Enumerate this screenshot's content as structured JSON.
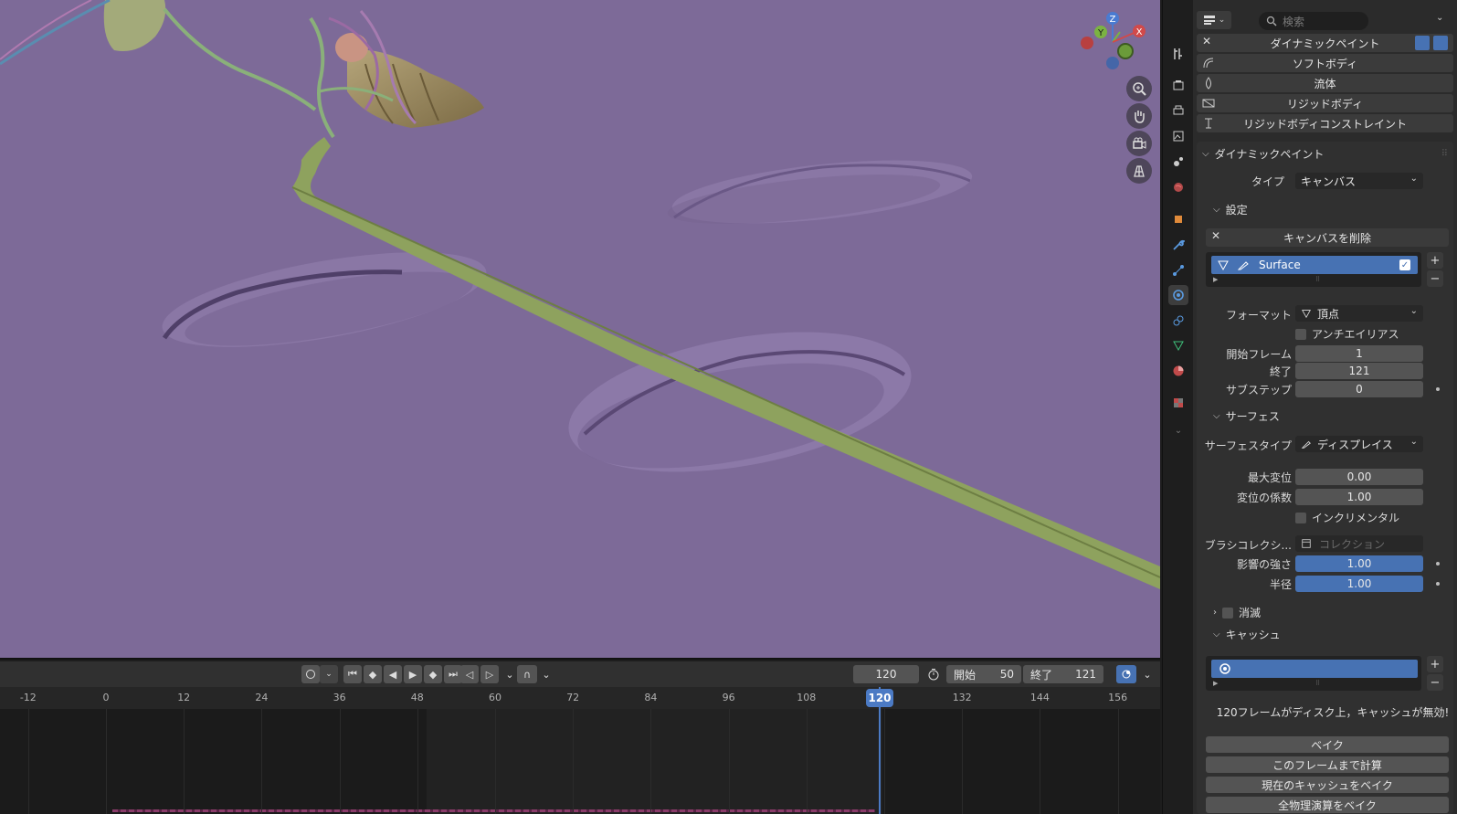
{
  "viewport": {
    "gizmo": {
      "z": "Z",
      "y": "Y",
      "x": "X"
    },
    "tools": [
      "zoom-icon",
      "hand-icon",
      "camera-icon",
      "grid-icon"
    ]
  },
  "timeline": {
    "current_frame": "120",
    "start_label": "開始",
    "start_value": "50",
    "end_label": "終了",
    "end_value": "121",
    "ticks": [
      "-12",
      "0",
      "12",
      "24",
      "36",
      "48",
      "60",
      "72",
      "84",
      "96",
      "108",
      "120",
      "132",
      "144",
      "156"
    ],
    "playhead": "120"
  },
  "properties": {
    "search_placeholder": "検索",
    "modifiers": [
      "ダイナミックペイント",
      "ソフトボディ",
      "流体",
      "リジッドボディ",
      "リジッドボディコンストレイント"
    ],
    "panel_title": "ダイナミックペイント",
    "type_label": "タイプ",
    "type_value": "キャンバス",
    "settings_title": "設定",
    "remove_canvas": "キャンバスを削除",
    "surface_item": "Surface",
    "format_label": "フォーマット",
    "format_value": "頂点",
    "antialias_label": "アンチエイリアス",
    "start_frame_label": "開始フレーム",
    "start_frame_value": "1",
    "end_label": "終了",
    "end_value": "121",
    "substeps_label": "サブステップ",
    "substeps_value": "0",
    "surface_title": "サーフェス",
    "surface_type_label": "サーフェスタイプ",
    "surface_type_value": "ディスプレイス",
    "max_disp_label": "最大変位",
    "max_disp_value": "0.00",
    "disp_factor_label": "変位の係数",
    "disp_factor_value": "1.00",
    "incremental_label": "インクリメンタル",
    "brush_collection_label": "ブラシコレクシ...",
    "brush_collection_placeholder": "コレクション",
    "influence_label": "影響の強さ",
    "influence_value": "1.00",
    "radius_label": "半径",
    "radius_value": "1.00",
    "dissolve_title": "消滅",
    "cache_title": "キャッシュ",
    "cache_status": "120フレームがディスク上，キャッシュが無効!",
    "bake": "ベイク",
    "calc_to_frame": "このフレームまで計算",
    "bake_current_cache": "現在のキャッシュをベイク",
    "bake_all": "全物理演算をベイク"
  }
}
